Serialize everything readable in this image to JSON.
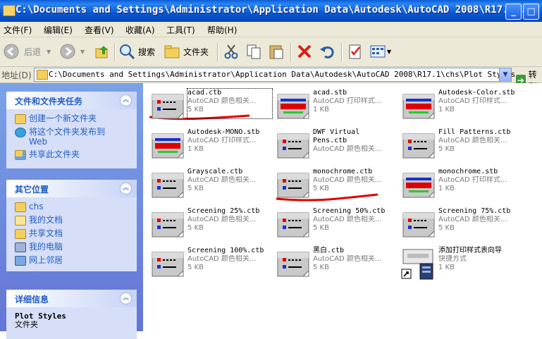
{
  "window": {
    "title": "C:\\Documents and Settings\\Administrator\\Application Data\\Autodesk\\AutoCAD 2008\\R17.1...",
    "buttons": [
      "_",
      "□"
    ]
  },
  "menu": [
    "文件(F)",
    "编辑(E)",
    "查看(V)",
    "收藏(A)",
    "工具(T)",
    "帮助(H)"
  ],
  "toolbar": {
    "back_label": "后退",
    "search_label": "搜索",
    "folders_label": "文件夹"
  },
  "address": {
    "label": "地址(D)",
    "path": "C:\\Documents and Settings\\Administrator\\Application Data\\Autodesk\\AutoCAD 2008\\R17.1\\chs\\Plot Styles",
    "go_label": "转到"
  },
  "sidebar": {
    "tasks": {
      "title": "文件和文件夹任务",
      "items": [
        {
          "label": "创建一个新文件夹",
          "icon": "new-folder-icon"
        },
        {
          "label": "将这个文件夹发布到\nWeb",
          "icon": "publish-web-icon"
        },
        {
          "label": "共享此文件夹",
          "icon": "share-folder-icon"
        }
      ]
    },
    "places": {
      "title": "其它位置",
      "items": [
        {
          "label": "chs",
          "icon": "folder-icon"
        },
        {
          "label": "我的文档",
          "icon": "my-documents-icon"
        },
        {
          "label": "共享文档",
          "icon": "shared-documents-icon"
        },
        {
          "label": "我的电脑",
          "icon": "my-computer-icon"
        },
        {
          "label": "网上邻居",
          "icon": "network-icon"
        }
      ]
    },
    "details": {
      "title": "详细信息",
      "name": "Plot Styles",
      "type": "文件夹"
    }
  },
  "files": [
    {
      "name": "acad.ctb",
      "type": "AutoCAD 颜色相关...",
      "size": "5 KB",
      "kind": "ctb",
      "selected": true
    },
    {
      "name": "acad.stb",
      "type": "AutoCAD 打印样式...",
      "size": "1 KB",
      "kind": "stb"
    },
    {
      "name": "Autodesk-Color.stb",
      "type": "AutoCAD 打印样式...",
      "size": "1 KB",
      "kind": "stb"
    },
    {
      "name": "Autodesk-MONO.stb",
      "type": "AutoCAD 打印样式...",
      "size": "1 KB",
      "kind": "stb"
    },
    {
      "name": "DWF Virtual\nPens.ctb",
      "type": "AutoCAD 颜色相关...",
      "size": "",
      "kind": "ctb"
    },
    {
      "name": "Fill Patterns.ctb",
      "type": "AutoCAD 颜色相关...",
      "size": "5 KB",
      "kind": "ctb"
    },
    {
      "name": "Grayscale.ctb",
      "type": "AutoCAD 颜色相关...",
      "size": "5 KB",
      "kind": "ctb"
    },
    {
      "name": "monochrome.ctb",
      "type": "AutoCAD 颜色相关...",
      "size": "5 KB",
      "kind": "ctb"
    },
    {
      "name": "monochrome.stb",
      "type": "AutoCAD 打印样式...",
      "size": "1 KB",
      "kind": "stb"
    },
    {
      "name": "Screening 25%.ctb",
      "type": "AutoCAD 颜色相关...",
      "size": "5 KB",
      "kind": "ctb"
    },
    {
      "name": "Screening 50%.ctb",
      "type": "AutoCAD 颜色相关...",
      "size": "5 KB",
      "kind": "ctb"
    },
    {
      "name": "Screening 75%.ctb",
      "type": "AutoCAD 颜色相关...",
      "size": "5 KB",
      "kind": "ctb"
    },
    {
      "name": "Screening 100%.ctb",
      "type": "AutoCAD 颜色相关...",
      "size": "5 KB",
      "kind": "ctb"
    },
    {
      "name": "黑白.ctb",
      "type": "AutoCAD 颜色相关...",
      "size": "5 KB",
      "kind": "ctb"
    },
    {
      "name": "添加打印样式表向导",
      "type": "快捷方式",
      "size": "1 KB",
      "kind": "wizard"
    }
  ],
  "colors": {
    "title_bar": "#0a5fd8",
    "sidebar": "#6f8fe0",
    "link": "#215dc6",
    "annotation": "#e00000"
  }
}
